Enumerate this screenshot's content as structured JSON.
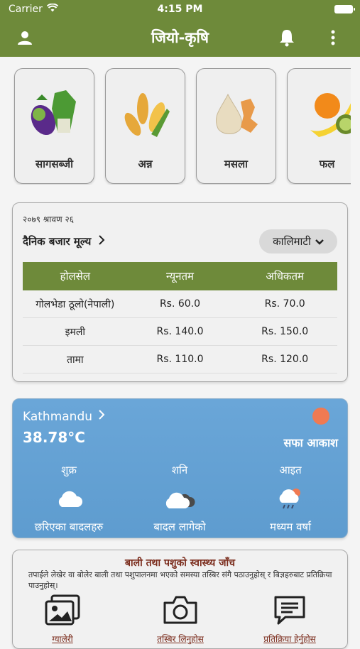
{
  "status": {
    "carrier": "Carrier",
    "time": "4:15 PM"
  },
  "header": {
    "title": "जियो-कृषि"
  },
  "categories": [
    {
      "label": "सागसब्जी",
      "icon": "vegetables-icon"
    },
    {
      "label": "अन्न",
      "icon": "grains-icon"
    },
    {
      "label": "मसला",
      "icon": "spices-icon"
    },
    {
      "label": "फल",
      "icon": "fruits-icon"
    }
  ],
  "market": {
    "date": "२०७९ श्रावण २६",
    "heading": "दैनिक बजार मूल्य",
    "location": "कालिमाटी",
    "columns": [
      "होलसेल",
      "न्यूनतम",
      "अधिकतम"
    ],
    "rows": [
      [
        "गोलभेडा ठूलो(नेपाली)",
        "Rs. 60.0",
        "Rs. 70.0"
      ],
      [
        "इमली",
        "Rs. 140.0",
        "Rs. 150.0"
      ],
      [
        "तामा",
        "Rs. 110.0",
        "Rs. 120.0"
      ]
    ]
  },
  "weather": {
    "city": "Kathmandu",
    "temp": "38.78°C",
    "condition": "सफा आकाश",
    "forecast": [
      {
        "day": "शुक्र",
        "desc": "छरिएका बादलहरु",
        "icon": "cloud-icon"
      },
      {
        "day": "शनि",
        "desc": "बादल लागेको",
        "icon": "dark-cloud-icon"
      },
      {
        "day": "आइत",
        "desc": "मध्यम वर्षा",
        "icon": "rain-icon"
      }
    ]
  },
  "health": {
    "title": "बाली तथा पशुको स्वास्थ्य जाँच",
    "subtitle": "तपाईले लेखेर वा बोलेर बाली तथा पशुपालनमा भएको समस्या तस्बिर संगै पठाउनुहोस् र बिज्ञहरुबाट प्रतिक्रिया पाउनुहोस्।",
    "actions": [
      {
        "label": "ग्यालेरी"
      },
      {
        "label": "तस्बिर लिनुहोस"
      },
      {
        "label": "प्रतिक्रिया हेर्नुहोस"
      }
    ]
  },
  "colors": {
    "primary": "#6e8a3a",
    "weather": "#6aa6d8",
    "accent": "#7a2b1b"
  }
}
